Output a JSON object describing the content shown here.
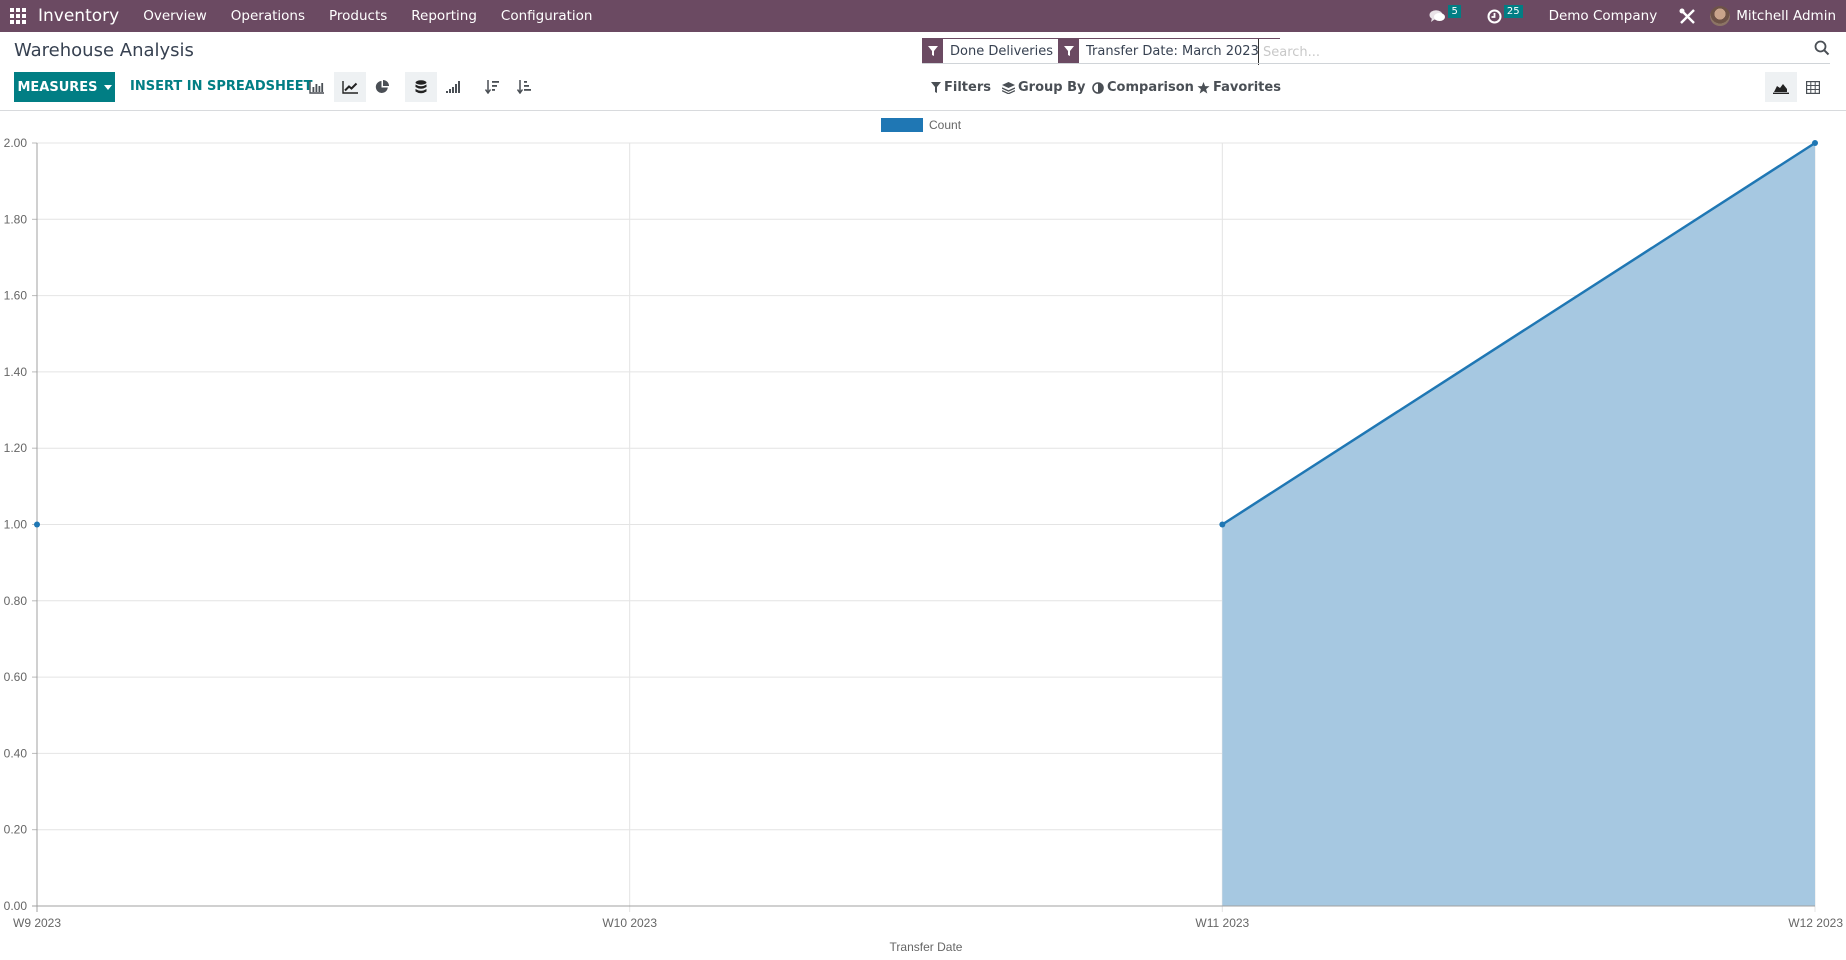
{
  "navbar": {
    "app_name": "Inventory",
    "menu": [
      "Overview",
      "Operations",
      "Products",
      "Reporting",
      "Configuration"
    ],
    "messages_count": "5",
    "activities_count": "25",
    "company": "Demo Company",
    "user": "Mitchell Admin",
    "icons": [
      "apps-grid-icon",
      "chat-icon",
      "clock-icon",
      "debug-tools-icon",
      "avatar"
    ]
  },
  "page": {
    "title": "Warehouse Analysis"
  },
  "toolbar": {
    "measures_label": "MEASURES",
    "spreadsheet_label": "INSERT IN SPREADSHEET",
    "chart_type_buttons": [
      "bar-chart-icon",
      "line-chart-icon",
      "pie-chart-icon"
    ],
    "active_chart_type": "line",
    "stacked_active": true,
    "options": [
      "stacked-icon",
      "cumulative-icon",
      "sort-descending-icon",
      "sort-ascending-icon"
    ]
  },
  "search": {
    "facets": [
      {
        "label": "Done Deliveries"
      },
      {
        "label": "Transfer Date: March 2023"
      }
    ],
    "placeholder": "Search...",
    "filters_label": "Filters",
    "groupby_label": "Group By",
    "comparison_label": "Comparison",
    "favorites_label": "Favorites"
  },
  "views": {
    "items": [
      "graph-view",
      "pivot-view"
    ],
    "active": "graph-view"
  },
  "colors": {
    "brand": "#6b4a62",
    "accent": "#017e84",
    "series": "#1f77b4",
    "area_fill": "#a6c8e1"
  },
  "chart_data": {
    "type": "area",
    "title": "",
    "xlabel": "Transfer Date",
    "ylabel": "",
    "categories": [
      "W9 2023",
      "W10 2023",
      "W11 2023",
      "W12 2023"
    ],
    "series": [
      {
        "name": "Count",
        "values": [
          1,
          null,
          1,
          2
        ]
      }
    ],
    "ylim": [
      0,
      2
    ],
    "yticks": [
      "0.00",
      "0.20",
      "0.40",
      "0.60",
      "0.80",
      "1.00",
      "1.20",
      "1.40",
      "1.60",
      "1.80",
      "2.00"
    ],
    "grid": true,
    "legend": "top-center"
  }
}
